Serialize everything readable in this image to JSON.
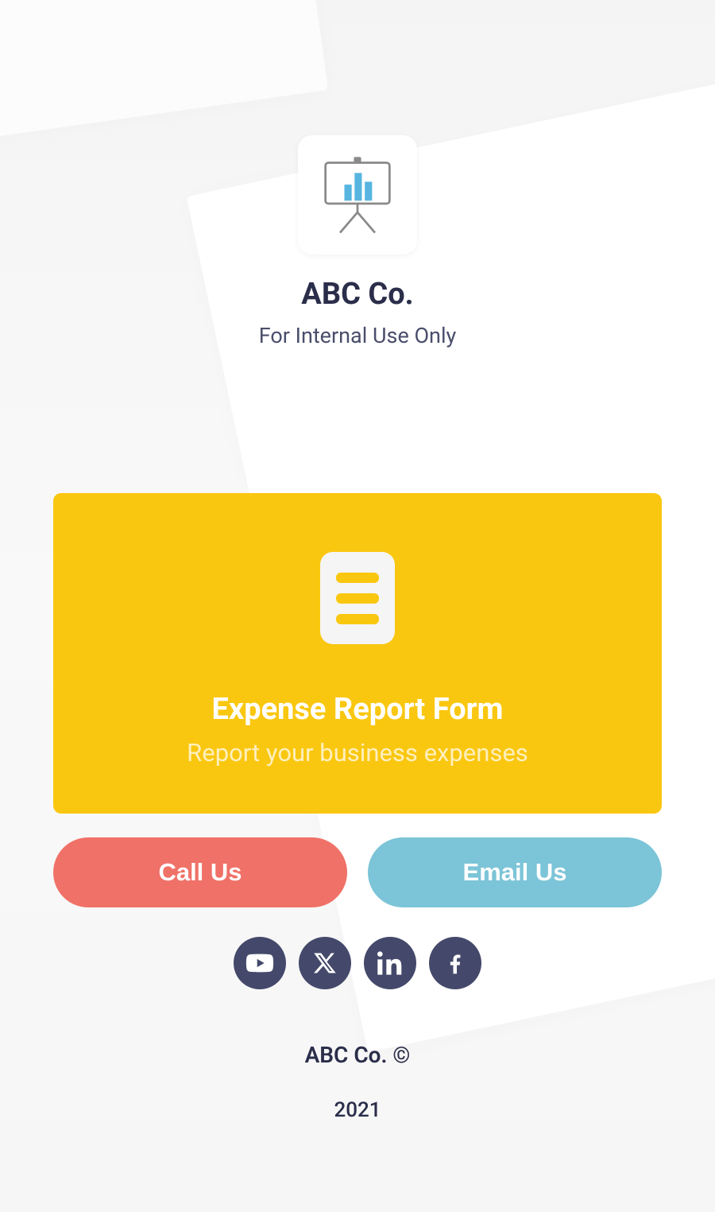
{
  "header": {
    "company_name": "ABC Co.",
    "subtitle": "For Internal Use Only"
  },
  "card": {
    "title": "Expense Report Form",
    "subtitle": "Report your business expenses"
  },
  "actions": {
    "call_label": "Call Us",
    "email_label": "Email Us"
  },
  "social": {
    "youtube": "youtube",
    "x": "x",
    "linkedin": "linkedin",
    "facebook": "facebook"
  },
  "footer": {
    "line": "ABC Co. ©",
    "year": "2021"
  },
  "colors": {
    "accent_card": "#fac710",
    "btn_call": "#f07167",
    "btn_email": "#7cc4d8",
    "social_bg": "#44496b"
  }
}
